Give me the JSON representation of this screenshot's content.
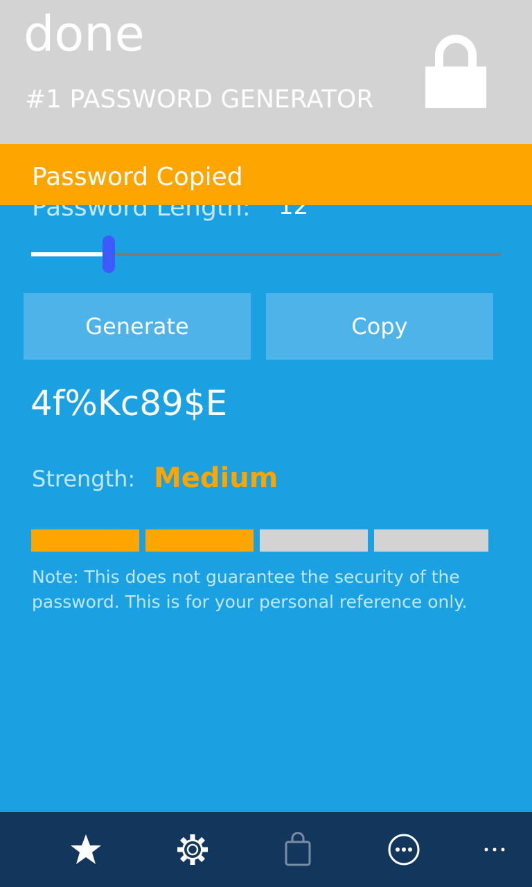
{
  "header": {
    "app_name": "done",
    "subtitle": "#1 PASSWORD GENERATOR",
    "icon": "lock-icon"
  },
  "toast": {
    "message": "Password Copied"
  },
  "length": {
    "label": "Password Length:",
    "value": "12",
    "slider_fraction": 0.165
  },
  "buttons": {
    "generate_label": "Generate",
    "copy_label": "Copy"
  },
  "password": {
    "value": "4f%Kc89$E"
  },
  "strength": {
    "label": "Strength:",
    "value": "Medium",
    "level": 2,
    "max_level": 4,
    "active_color": "#ffa500",
    "inactive_color": "#d3d3d3"
  },
  "note": "Note: This does not guarantee the security of the password. This is for your personal reference only.",
  "appbar": {
    "icons": [
      "star-icon",
      "gear-icon",
      "shopping-bag-icon",
      "password-dots-icon",
      "more-icon"
    ]
  },
  "colors": {
    "background": "#1ba1e2",
    "header": "#d3d3d3",
    "accent": "#ffa500",
    "button": "#4db3e9",
    "appbar": "#13375c",
    "slider_thumb": "#3d5afe"
  }
}
